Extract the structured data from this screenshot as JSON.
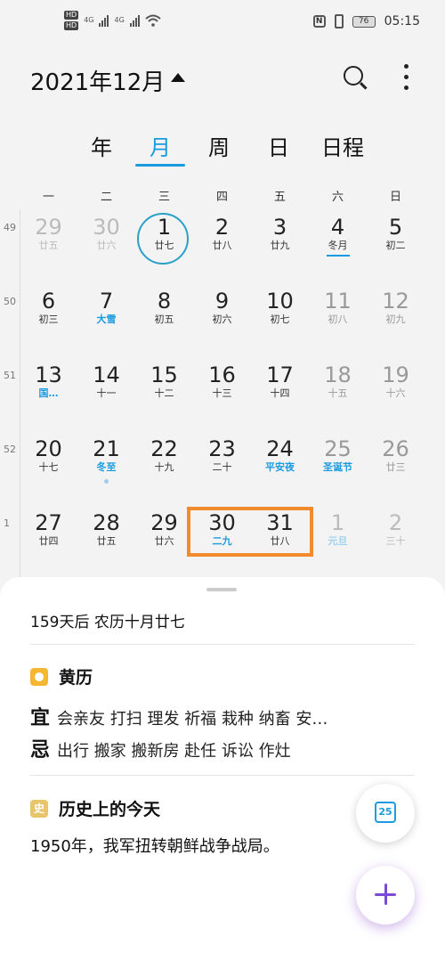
{
  "status_bar": {
    "hd1": "HD",
    "hd2": "HD",
    "net1": "4G",
    "net2": "4G",
    "battery": "76",
    "time": "05:15"
  },
  "header": {
    "month_title": "2021年12月"
  },
  "tabs": [
    "年",
    "月",
    "周",
    "日",
    "日程"
  ],
  "weekdays": [
    "一",
    "二",
    "三",
    "四",
    "五",
    "六",
    "日"
  ],
  "weeks": [
    {
      "num": "49",
      "days": [
        {
          "d": "29",
          "l": "廿五",
          "muted": true
        },
        {
          "d": "30",
          "l": "廿六",
          "muted": true
        },
        {
          "d": "1",
          "l": "廿七",
          "today": true
        },
        {
          "d": "2",
          "l": "廿八"
        },
        {
          "d": "3",
          "l": "廿九"
        },
        {
          "d": "4",
          "l": "冬月",
          "underline": true
        },
        {
          "d": "5",
          "l": "初二"
        }
      ]
    },
    {
      "num": "50",
      "days": [
        {
          "d": "6",
          "l": "初三"
        },
        {
          "d": "7",
          "l": "大雪",
          "festival": true
        },
        {
          "d": "8",
          "l": "初五"
        },
        {
          "d": "9",
          "l": "初六"
        },
        {
          "d": "10",
          "l": "初七"
        },
        {
          "d": "11",
          "l": "初八",
          "weekend": true
        },
        {
          "d": "12",
          "l": "初九",
          "weekend": true
        }
      ]
    },
    {
      "num": "51",
      "days": [
        {
          "d": "13",
          "l": "国…",
          "festival": true
        },
        {
          "d": "14",
          "l": "十一"
        },
        {
          "d": "15",
          "l": "十二"
        },
        {
          "d": "16",
          "l": "十三"
        },
        {
          "d": "17",
          "l": "十四"
        },
        {
          "d": "18",
          "l": "十五",
          "weekend": true
        },
        {
          "d": "19",
          "l": "十六",
          "weekend": true
        }
      ]
    },
    {
      "num": "52",
      "days": [
        {
          "d": "20",
          "l": "十七"
        },
        {
          "d": "21",
          "l": "冬至",
          "festival": true,
          "dot": true
        },
        {
          "d": "22",
          "l": "十九"
        },
        {
          "d": "23",
          "l": "二十"
        },
        {
          "d": "24",
          "l": "平安夜",
          "festival": true
        },
        {
          "d": "25",
          "l": "圣诞节",
          "festival": true,
          "weekend": true
        },
        {
          "d": "26",
          "l": "廿三",
          "weekend": true
        }
      ]
    },
    {
      "num": "1",
      "days": [
        {
          "d": "27",
          "l": "廿四"
        },
        {
          "d": "28",
          "l": "廿五"
        },
        {
          "d": "29",
          "l": "廿六"
        },
        {
          "d": "30",
          "l": "二九",
          "festival": true
        },
        {
          "d": "31",
          "l": "廿八"
        },
        {
          "d": "1",
          "l": "元旦",
          "muted": true,
          "festival": true
        },
        {
          "d": "2",
          "l": "三十",
          "muted": true
        }
      ]
    }
  ],
  "detail": {
    "countdown": "159天后 农历十月廿七",
    "almanac_title": "黄历",
    "yi_label": "宜",
    "yi_items": "会亲友 打扫 理发 祈福 栽种 纳畜 安…",
    "ji_label": "忌",
    "ji_items": "出行 搬家 搬新房 赴任 诉讼 作灶",
    "history_title": "历史上的今天",
    "history_text": "1950年，我军扭转朝鲜战争战局。"
  },
  "fab": {
    "calendar_day": "25"
  },
  "colors": {
    "accent": "#1a9be0",
    "selection": "#f28a2e",
    "fab_plus": "#7b4bd6"
  }
}
